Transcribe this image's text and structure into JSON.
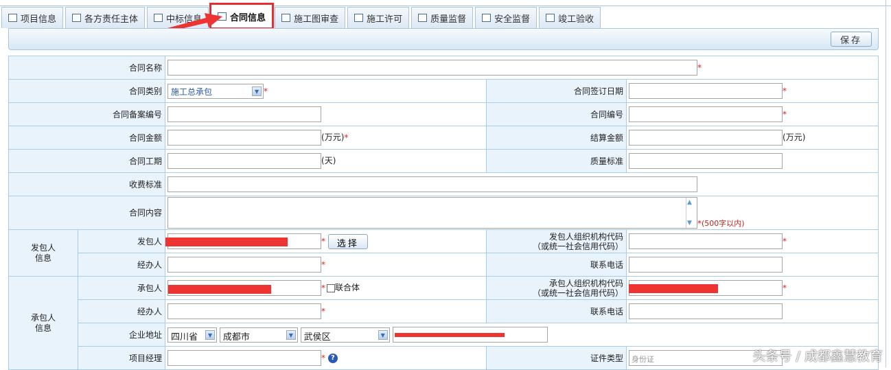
{
  "tabs": [
    "项目信息",
    "各方责任主体",
    "中标信息",
    "合同信息",
    "施工图审查",
    "施工许可",
    "质量监督",
    "安全监督",
    "竣工验收"
  ],
  "active_tab": "合同信息",
  "toolbar": {
    "save_label": "保存"
  },
  "form": {
    "contract_name": "合同名称",
    "contract_type": "合同类别",
    "contract_type_value": "施工总承包",
    "sign_date": "合同签订日期",
    "filing_no": "合同备案编号",
    "contract_no": "合同编号",
    "amount": "合同金额",
    "amount_unit": "(万元)",
    "settle": "结算金额",
    "settle_unit": "(万元)",
    "period": "合同工期",
    "period_unit": "(天)",
    "quality": "质量标准",
    "fee": "收费标准",
    "content": "合同内容",
    "content_hint": "(500字以内)",
    "employer_group": "发包人\n信息",
    "employer": "发包人",
    "select_label": "选择",
    "employer_code": "发包人组织机构代码",
    "code_sub": "（或统一社会信用代码）",
    "handler": "经办人",
    "phone": "联系电话",
    "contractor_group": "承包人\n信息",
    "contractor": "承包人",
    "consortium": "联合体",
    "contractor_code": "承包人组织机构代码",
    "address": "企业地址",
    "province": "四川省",
    "city": "成都市",
    "district": "武侯区",
    "pm": "项目经理",
    "id_type": "证件类型",
    "id_type_value": "身份证"
  },
  "watermark": "头条号 / 成都鑫慧教育"
}
